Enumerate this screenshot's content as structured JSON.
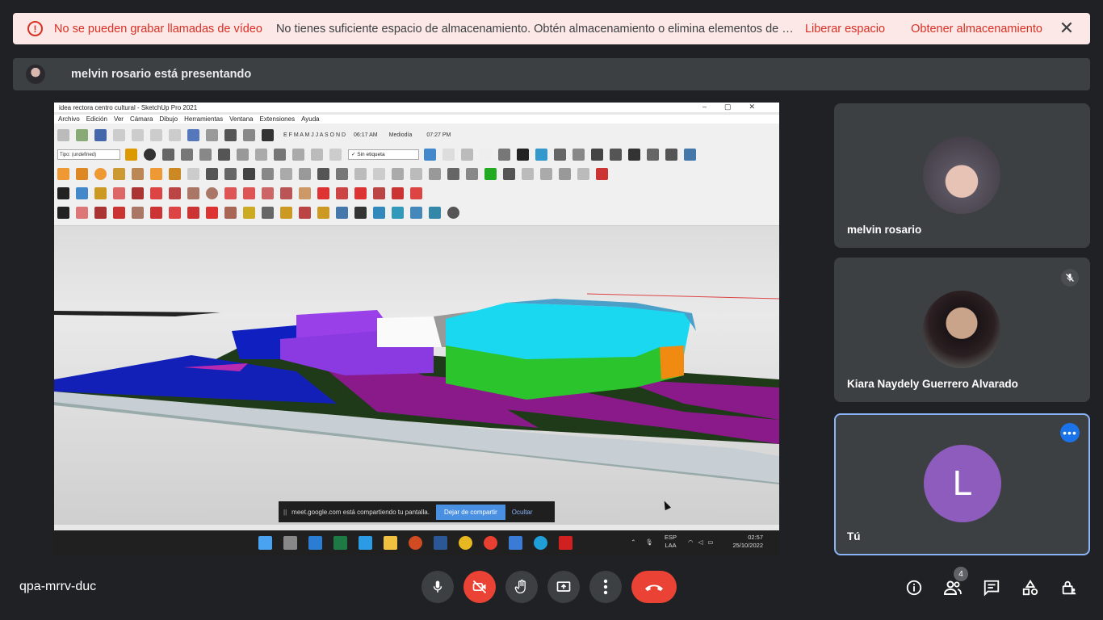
{
  "banner": {
    "title": "No se pueden grabar llamadas de vídeo",
    "message": "No tienes suficiente espacio de almacenamiento. Obtén almacenamiento o elimina elementos de G...",
    "action_free": "Liberar espacio",
    "action_get": "Obtener almacenamiento",
    "close_glyph": "✕"
  },
  "presenter": {
    "text": "melvin rosario está presentando"
  },
  "shared_screen": {
    "window_title": "idea rectora centro cultural - SketchUp Pro 2021",
    "menu": [
      "Archivo",
      "Edición",
      "Ver",
      "Cámara",
      "Dibujo",
      "Herramientas",
      "Ventana",
      "Extensiones",
      "Ayuda"
    ],
    "months": "E F M A M J J A S O N D",
    "time_start": "06:17 AM",
    "time_mid": "Mediodía",
    "time_end": "07:27 PM",
    "tag_dropdown": "Tipo: (undefined)",
    "tag_label": "✓ Sin etiqueta",
    "share_notice": "meet.google.com está compartiendo tu pantalla.",
    "stop_share": "Dejar de compartir",
    "hide": "Ocultar",
    "tray_lang_1": "ESP",
    "tray_lang_2": "LAA",
    "tray_time": "02:57",
    "tray_date": "25/10/2022"
  },
  "participants": [
    {
      "name": "melvin rosario"
    },
    {
      "name": "Kiara Naydely Guerrero Alvarado",
      "muted": true
    },
    {
      "name": "Tú",
      "initial": "L",
      "avatar_color": "#8e5cbd"
    }
  ],
  "meeting_code": "qpa-mrrv-duc",
  "participant_count": "4",
  "colors": {
    "accent": "#8ab4f8",
    "danger": "#ea4335",
    "tile_bg": "#3c4043",
    "page_bg": "#202124"
  }
}
